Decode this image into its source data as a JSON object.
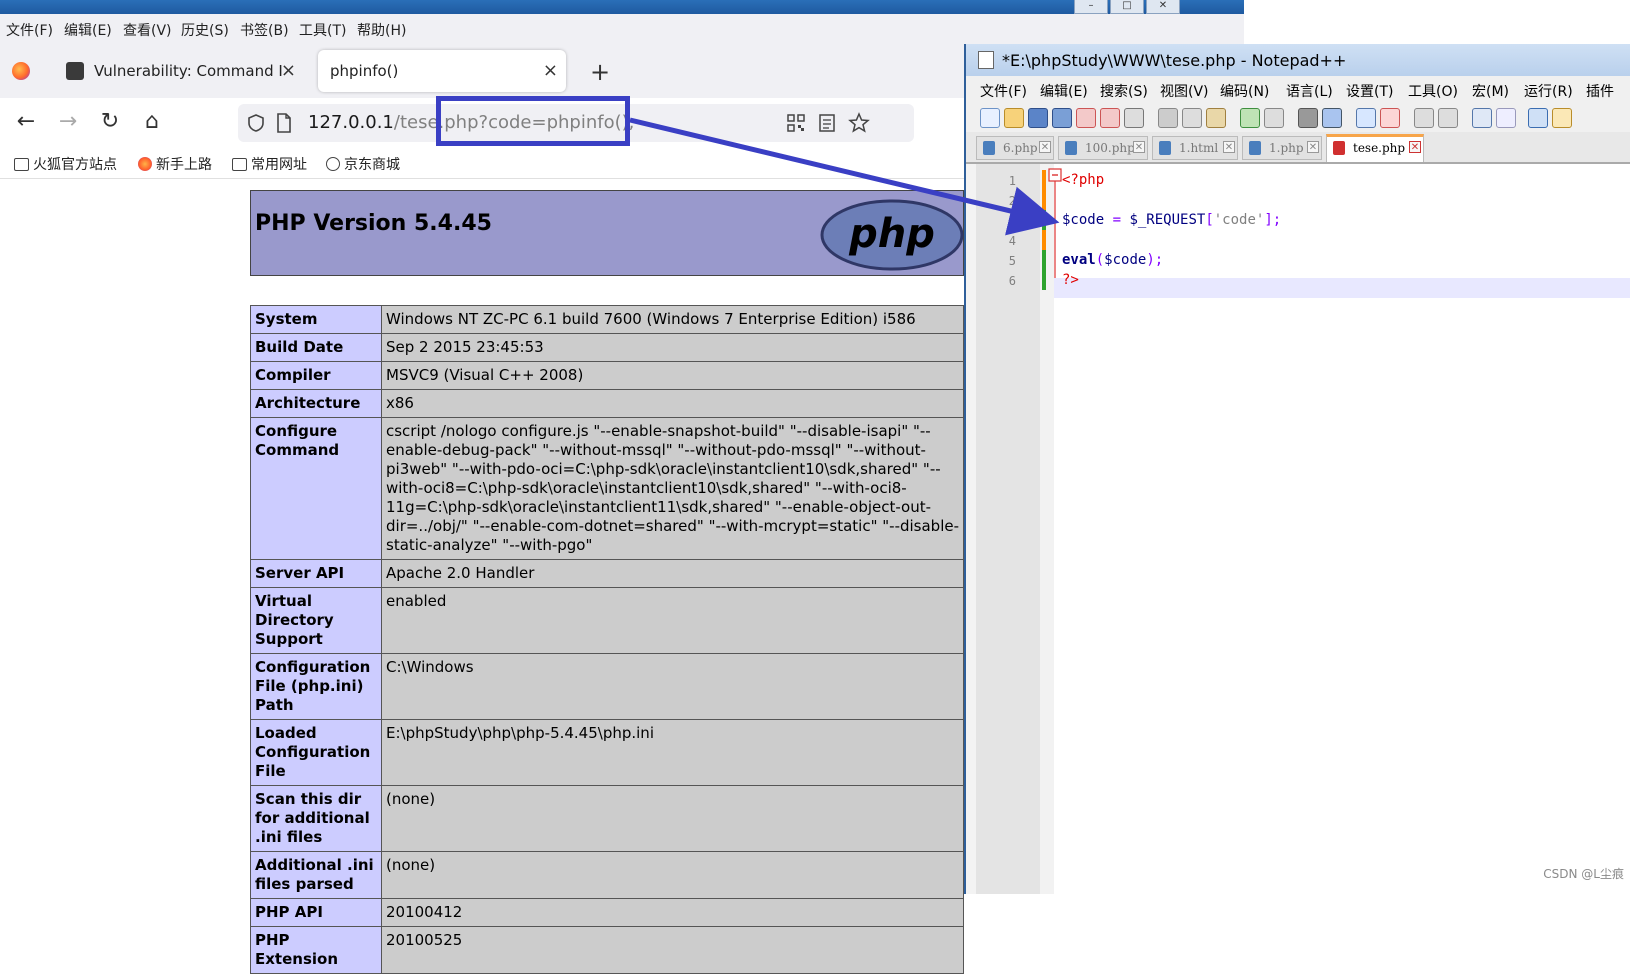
{
  "firefox": {
    "menubar": [
      "文件(F)",
      "编辑(E)",
      "查看(V)",
      "历史(S)",
      "书签(B)",
      "工具(T)",
      "帮助(H)"
    ],
    "tabs": [
      {
        "label": "Vulnerability: Command Inje"
      },
      {
        "label": "phpinfo()"
      }
    ],
    "url": {
      "host": "127.0.0.1",
      "rest": "/tese.php?code=phpinfo();"
    },
    "bookmarks": [
      "火狐官方站点",
      "新手上路",
      "常用网址",
      "京东商城"
    ]
  },
  "phpinfo": {
    "version_title": "PHP Version 5.4.45",
    "logo_text": "php",
    "rows": [
      {
        "key": "System",
        "value": "Windows NT ZC-PC 6.1 build 7600 (Windows 7 Enterprise Edition) i586"
      },
      {
        "key": "Build Date",
        "value": "Sep 2 2015 23:45:53"
      },
      {
        "key": "Compiler",
        "value": "MSVC9 (Visual C++ 2008)"
      },
      {
        "key": "Architecture",
        "value": "x86"
      },
      {
        "key": "Configure Command",
        "value": "cscript /nologo configure.js \"--enable-snapshot-build\" \"--disable-isapi\" \"--enable-debug-pack\" \"--without-mssql\" \"--without-pdo-mssql\" \"--without-pi3web\" \"--with-pdo-oci=C:\\php-sdk\\oracle\\instantclient10\\sdk,shared\" \"--with-oci8=C:\\php-sdk\\oracle\\instantclient10\\sdk,shared\" \"--with-oci8-11g=C:\\php-sdk\\oracle\\instantclient11\\sdk,shared\" \"--enable-object-out-dir=../obj/\" \"--enable-com-dotnet=shared\" \"--with-mcrypt=static\" \"--disable-static-analyze\" \"--with-pgo\""
      },
      {
        "key": "Server API",
        "value": "Apache 2.0 Handler"
      },
      {
        "key": "Virtual Directory Support",
        "value": "enabled"
      },
      {
        "key": "Configuration File (php.ini) Path",
        "value": "C:\\Windows"
      },
      {
        "key": "Loaded Configuration File",
        "value": "E:\\phpStudy\\php\\php-5.4.45\\php.ini"
      },
      {
        "key": "Scan this dir for additional .ini files",
        "value": "(none)"
      },
      {
        "key": "Additional .ini files parsed",
        "value": "(none)"
      },
      {
        "key": "PHP API",
        "value": "20100412"
      },
      {
        "key": "PHP Extension",
        "value": "20100525"
      }
    ]
  },
  "notepadpp": {
    "title": "*E:\\phpStudy\\WWW\\tese.php - Notepad++",
    "menu": [
      "文件(F)",
      "编辑(E)",
      "搜索(S)",
      "视图(V)",
      "编码(N)",
      "语言(L)",
      "设置(T)",
      "工具(O)",
      "宏(M)",
      "运行(R)",
      "插件"
    ],
    "tabs": [
      "6.php",
      "100.php",
      "1.html",
      "1.php",
      "tese.php"
    ],
    "active_tab": "tese.php",
    "line_numbers": [
      "1",
      "2",
      "3",
      "4",
      "5",
      "6"
    ],
    "code": {
      "l1": "<?php",
      "l3_var": "$code",
      "l3_op": " = ",
      "l3_req": "$_REQUEST",
      "l3_br1": "[",
      "l3_str": "'code'",
      "l3_br2": "];",
      "l5_fn": "eval",
      "l5_p1": "(",
      "l5_var": "$code",
      "l5_p2": ");",
      "l6": "?>"
    },
    "watermark": "CSDN @L尘痕"
  },
  "colors": {
    "annotation_blue": "#3a3fc4",
    "php_header": "#9999cc",
    "php_key_cell": "#ccccff",
    "php_value_cell": "#cccccc"
  }
}
